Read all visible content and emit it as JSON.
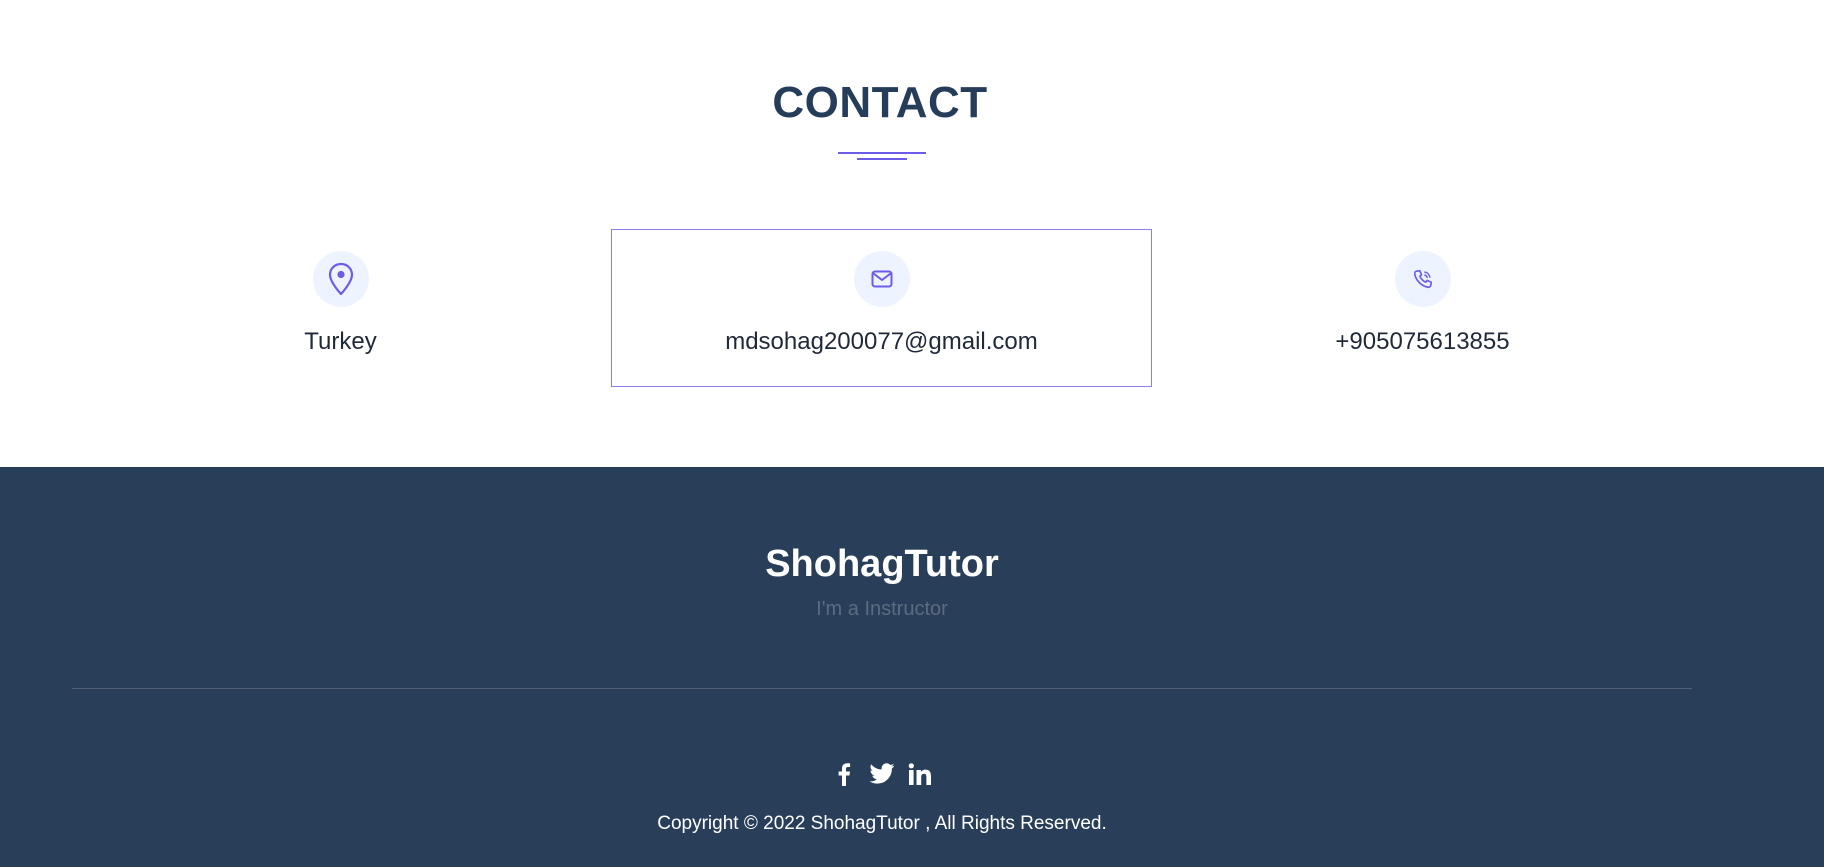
{
  "contact": {
    "title": "CONTACT",
    "items": [
      {
        "icon": "location-pin-icon",
        "text": "Turkey"
      },
      {
        "icon": "envelope-icon",
        "text": "mdsohag200077@gmail.com"
      },
      {
        "icon": "phone-icon",
        "text": "+905075613855"
      }
    ]
  },
  "footer": {
    "brand": "ShohagTutor",
    "tagline": "I'm a Instructor",
    "socials": [
      "facebook-icon",
      "twitter-icon",
      "linkedin-icon"
    ],
    "copyright": "Copyright © 2022 ShohagTutor , All Rights Reserved."
  },
  "colors": {
    "accent": "#6c5ce7",
    "heading": "#263d5a",
    "footer_bg": "#283e59",
    "icon_bg": "#eef4ff"
  }
}
